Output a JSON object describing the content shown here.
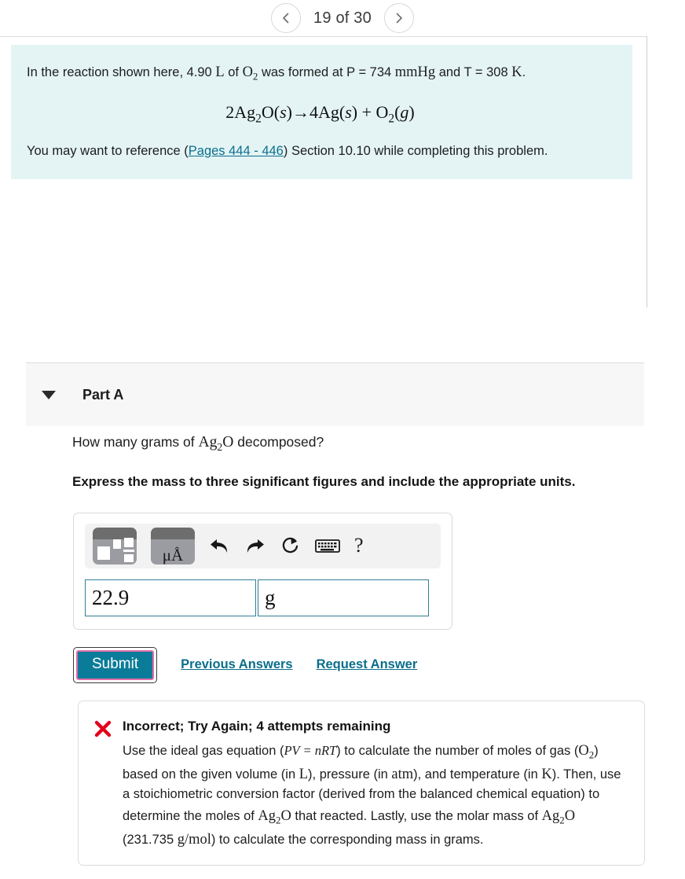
{
  "pager": {
    "prev_icon": "chevron-left-icon",
    "next_icon": "chevron-right-icon",
    "label": "19 of 30",
    "current": 19,
    "total": 30
  },
  "statement": {
    "intro_a": "In the reaction shown here, 4.90 ",
    "intro_unit": "L",
    "intro_b": " of ",
    "species": "O",
    "species_sub": "2",
    "intro_c": " was formed at P = 734 ",
    "pressure_unit": "mmHg",
    "intro_d": " and T = 308 ",
    "temp_unit": "K",
    "intro_e": ".",
    "equation": "2Ag₂O(s)→4Ag(s) + O₂(g)",
    "ref_before": "You may want to reference (",
    "ref_link": "Pages 444 - 446",
    "ref_after": ") Section 10.10 while completing this problem."
  },
  "part": {
    "title": "Part A",
    "caret_icon": "caret-down-icon",
    "question_before": "How many grams of ",
    "question_species": "Ag",
    "question_species_sub": "2",
    "question_species_after": "O",
    "question_after": " decomposed?",
    "instruction": "Express the mass to three significant figures and include the appropriate units."
  },
  "toolbar": {
    "template_icon": "formula-template-icon",
    "units_icon": "units-picker-icon",
    "units_label": "μÅ",
    "undo_icon": "undo-arrow-icon",
    "redo_icon": "redo-arrow-icon",
    "reset_icon": "reset-circular-arrow-icon",
    "keyboard_icon": "keyboard-icon",
    "help_icon": "question-mark-icon",
    "help_label": "?"
  },
  "answer": {
    "value": "22.9",
    "value_placeholder": "",
    "unit": "g",
    "unit_placeholder": ""
  },
  "actions": {
    "submit_label": "Submit",
    "previous_answers_label": "Previous Answers",
    "request_answer_label": "Request Answer"
  },
  "feedback": {
    "icon": "red-x-icon",
    "status": "Incorrect; Try Again; 4 attempts remaining",
    "attempts_remaining": 4,
    "body_1": "Use the ideal gas equation (",
    "equation_inline": "PV = nRT",
    "body_2": ") to calculate the number of moles of gas (",
    "gas": "O₂",
    "body_3": ") based on the given volume (in ",
    "unit_volume": "L",
    "body_4": "), pressure (in ",
    "unit_pressure": "atm",
    "body_5": "), and temperature (in ",
    "unit_temp": "K",
    "body_6": "). Then, use a stoichiometric conversion factor (derived from the balanced chemical equation) to determine the moles of ",
    "compound": "Ag₂O",
    "body_7": " that reacted. Lastly, use the molar mass of ",
    "compound_2": "Ag₂O",
    "body_8": " (231.735 ",
    "molar_unit": "g/mol",
    "body_9": ") to calculate the corresponding mass in grams.",
    "molar_mass": "231.735"
  },
  "colors": {
    "statement_bg": "#e4f4f5",
    "link": "#0a6e8c",
    "submit_bg": "#0a7c99",
    "submit_focus_ring": "#e06ea8",
    "error": "#e3001b",
    "field_border": "#2f7f95"
  }
}
